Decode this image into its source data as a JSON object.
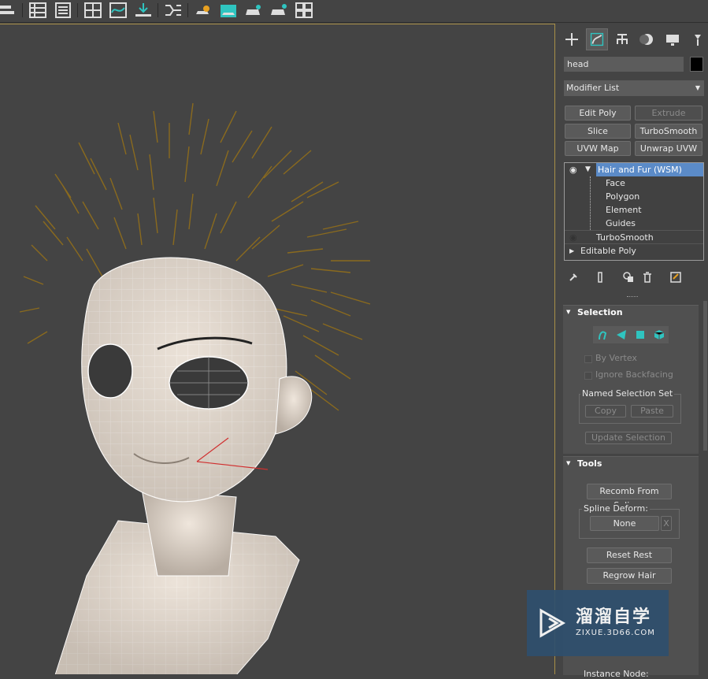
{
  "panel": {
    "object_name": "head",
    "modifier_list": "Modifier List",
    "buttons": {
      "edit_poly": "Edit Poly",
      "extrude": "Extrude",
      "slice": "Slice",
      "turbosmooth": "TurboSmooth",
      "uvw_map": "UVW Map",
      "unwrap_uvw": "Unwrap UVW"
    },
    "stack": {
      "hair_and_fur": "Hair and Fur (WSM)",
      "face": "Face",
      "polygon": "Polygon",
      "element": "Element",
      "guides": "Guides",
      "turbosmooth": "TurboSmooth",
      "editable_poly": "Editable Poly"
    },
    "selection": {
      "title": "Selection",
      "by_vertex": "By Vertex",
      "ignore_backfacing": "Ignore Backfacing",
      "named_selection_set": "Named Selection Set",
      "copy": "Copy",
      "paste": "Paste",
      "update_selection": "Update Selection"
    },
    "tools": {
      "title": "Tools",
      "recomb": "Recomb From Splines",
      "spline_deform": "Spline Deform:",
      "none": "None",
      "x": "X",
      "reset_rest": "Reset Rest",
      "regrow_hair": "Regrow Hair",
      "instance_node": "Instance Node:"
    }
  },
  "watermark": {
    "main": "溜溜自学",
    "sub": "ZIXUE.3D66.COM"
  },
  "colors": {
    "hair": "#8a6a1e",
    "accent_selected": "#5b8bc8",
    "icon_teal": "#2fc4c0",
    "viewport_border": "#a89048"
  },
  "icons": [
    "align-icon",
    "list-icon",
    "layers-icon",
    "schematic-icon",
    "curve-editor-icon",
    "render-setup-icon",
    "material-editor-icon",
    "render-icon",
    "teapot-icon",
    "teapot-render-icon",
    "grid-icon",
    "create-tab-icon",
    "modify-tab-icon",
    "hierarchy-tab-icon",
    "motion-tab-icon",
    "display-tab-icon",
    "utilities-tab-icon",
    "eye-icon",
    "pin-icon",
    "show-end-icon",
    "make-unique-icon",
    "remove-modifier-icon",
    "configure-icon"
  ]
}
